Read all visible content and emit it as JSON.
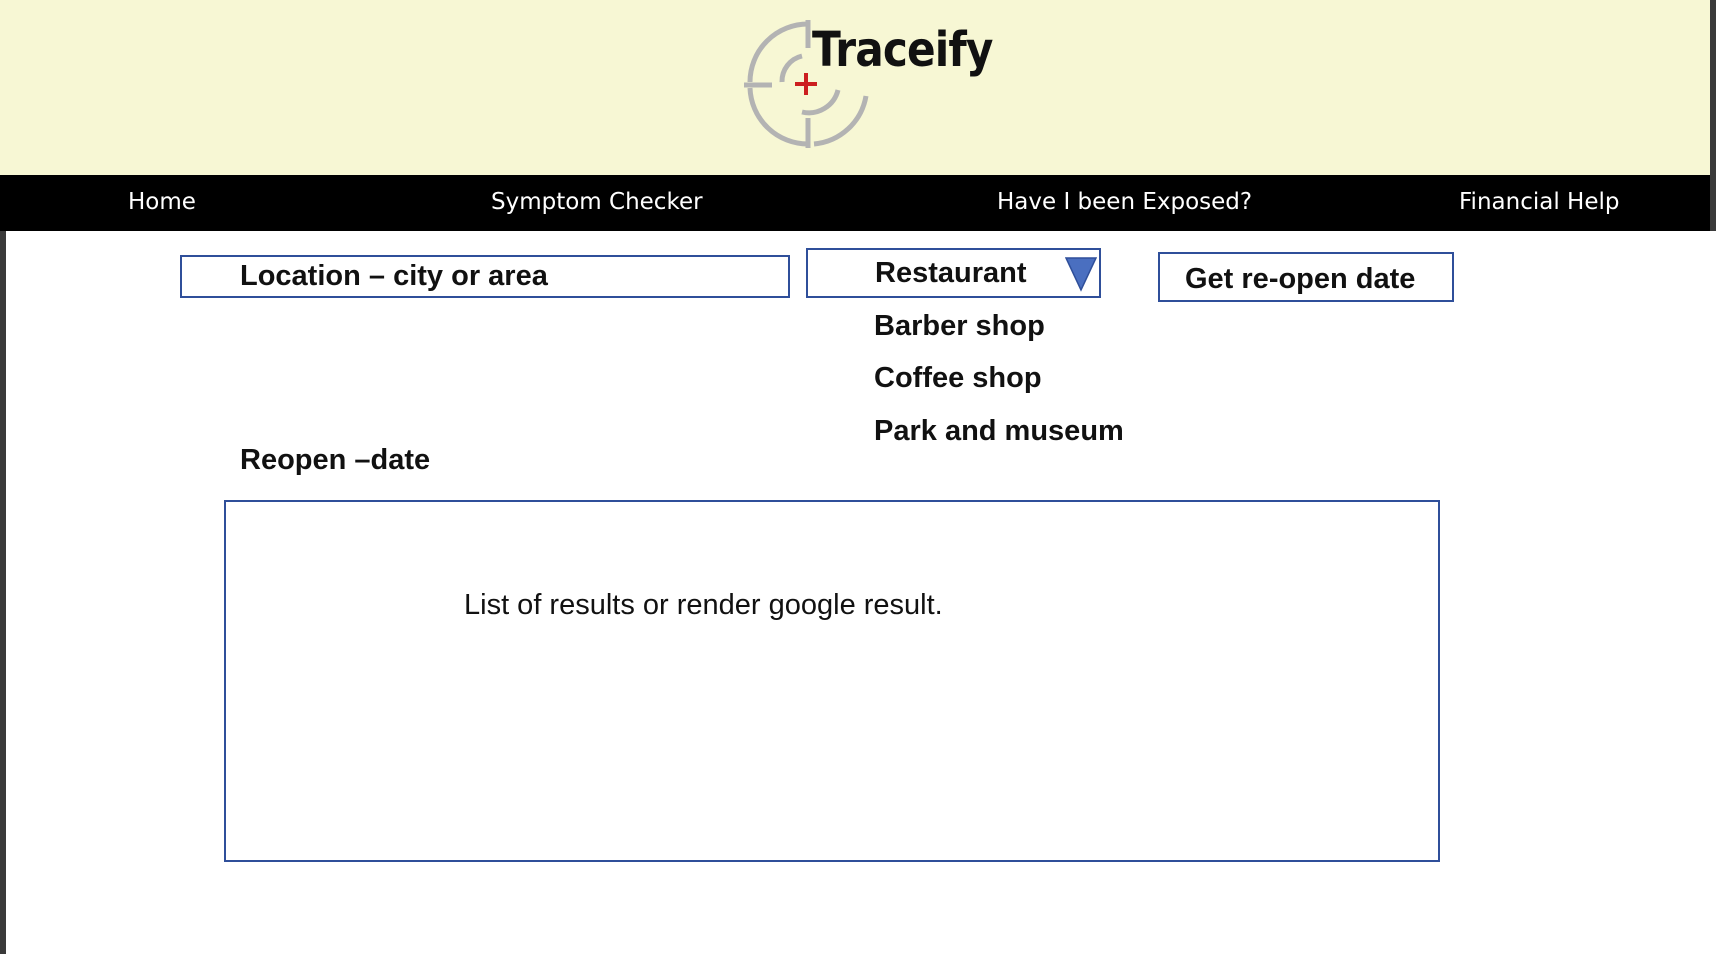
{
  "header": {
    "logo_text": "Traceify"
  },
  "nav": {
    "items": [
      {
        "label": "Home"
      },
      {
        "label": "Symptom Checker"
      },
      {
        "label": "Have I been Exposed?"
      },
      {
        "label": "Financial Help"
      }
    ]
  },
  "search": {
    "location_placeholder": "Location – city or area",
    "category_selected": "Restaurant",
    "category_options": [
      "Barber shop",
      "Coffee shop",
      "Park and museum"
    ],
    "submit_label": "Get re-open date"
  },
  "results": {
    "reopen_label": "Reopen –date",
    "placeholder_text": "List of results or render google result."
  },
  "colors": {
    "header_bg": "#f7f7d4",
    "nav_bg": "#000000",
    "field_border": "#2f4f9a",
    "arrow": "#4a6fc0",
    "logo_cross": "#cc1f1f",
    "logo_ring": "#b3b3b3"
  },
  "icons": {
    "logo": "crosshair-icon",
    "dropdown": "triangle-down-icon"
  }
}
